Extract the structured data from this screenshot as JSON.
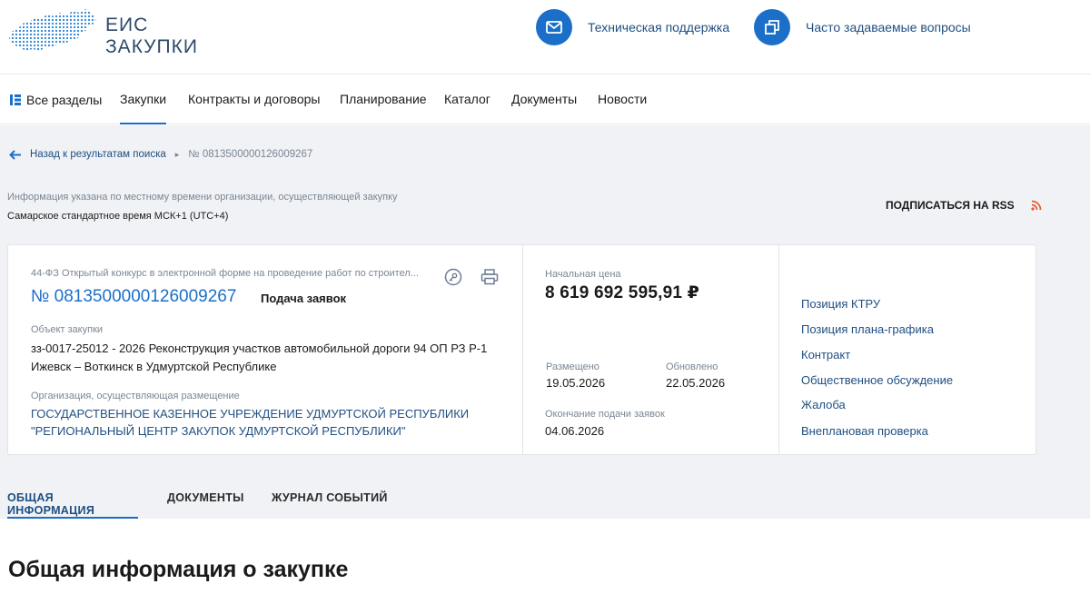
{
  "header": {
    "logo_line1": "ЕИС",
    "logo_line2": "ЗАКУПКИ",
    "support_label": "Техническая поддержка",
    "faq_label": "Часто задаваемые вопросы"
  },
  "nav": {
    "all_sections": "Все разделы",
    "items": [
      {
        "label": "Закупки"
      },
      {
        "label": "Контракты и договоры"
      },
      {
        "label": "Планирование"
      },
      {
        "label": "Каталог"
      },
      {
        "label": "Документы"
      },
      {
        "label": "Новости"
      }
    ]
  },
  "breadcrumb": {
    "back_label": "Назад к результатам поиска",
    "current": "№ 0813500000126009267"
  },
  "timezone": {
    "note": "Информация указана по местному времени организации, осуществляющей закупку",
    "value": "Самарское стандартное время МСК+1 (UTC+4)"
  },
  "rss_label": "ПОДПИСАТЬСЯ НА RSS",
  "procurement": {
    "type": "44-ФЗ Открытый конкурс в электронной форме на проведение работ по строител...",
    "number": "№ 0813500000126009267",
    "status": "Подача заявок",
    "object_label": "Объект закупки",
    "object_value": "зз-0017-25012 - 2026 Реконструкция участков автомобильной дороги 94 ОП РЗ Р-1 Ижевск – Воткинск в Удмуртской Республике",
    "org_label": "Организация, осуществляющая размещение",
    "org_value": "ГОСУДАРСТВЕННОЕ КАЗЕННОЕ УЧРЕЖДЕНИЕ УДМУРТСКОЙ РЕСПУБЛИКИ \"РЕГИОНАЛЬНЫЙ ЦЕНТР ЗАКУПОК УДМУРТСКОЙ РЕСПУБЛИКИ\"",
    "price_label": "Начальная цена",
    "price_value": "8 619 692 595,91 ₽",
    "posted_label": "Размещено",
    "posted_value": "19.05.2026",
    "updated_label": "Обновлено",
    "updated_value": "22.05.2026",
    "deadline_label": "Окончание подачи заявок",
    "deadline_value": "04.06.2026",
    "links": [
      {
        "label": "Позиция КТРУ"
      },
      {
        "label": "Позиция плана-графика"
      },
      {
        "label": "Контракт"
      },
      {
        "label": "Общественное обсуждение"
      },
      {
        "label": "Жалоба"
      },
      {
        "label": "Внеплановая проверка"
      }
    ]
  },
  "tabs": [
    {
      "label": "ОБЩАЯ ИНФОРМАЦИЯ"
    },
    {
      "label": "ДОКУМЕНТЫ"
    },
    {
      "label": "ЖУРНАЛ СОБЫТИЙ"
    }
  ],
  "section_title": "Общая информация о закупке",
  "colors": {
    "accent": "#1b6fc9",
    "link": "#1f4f82",
    "rss": "#e8582a",
    "background_grey": "#f0f2f5"
  },
  "icons": {
    "logo": "russia-map-logo",
    "support": "envelope-icon",
    "faq": "copy-windows-icon",
    "nav_all": "sections-grid-icon",
    "back": "arrow-left-icon",
    "rss": "rss-icon",
    "key": "key-icon",
    "print": "printer-icon"
  }
}
